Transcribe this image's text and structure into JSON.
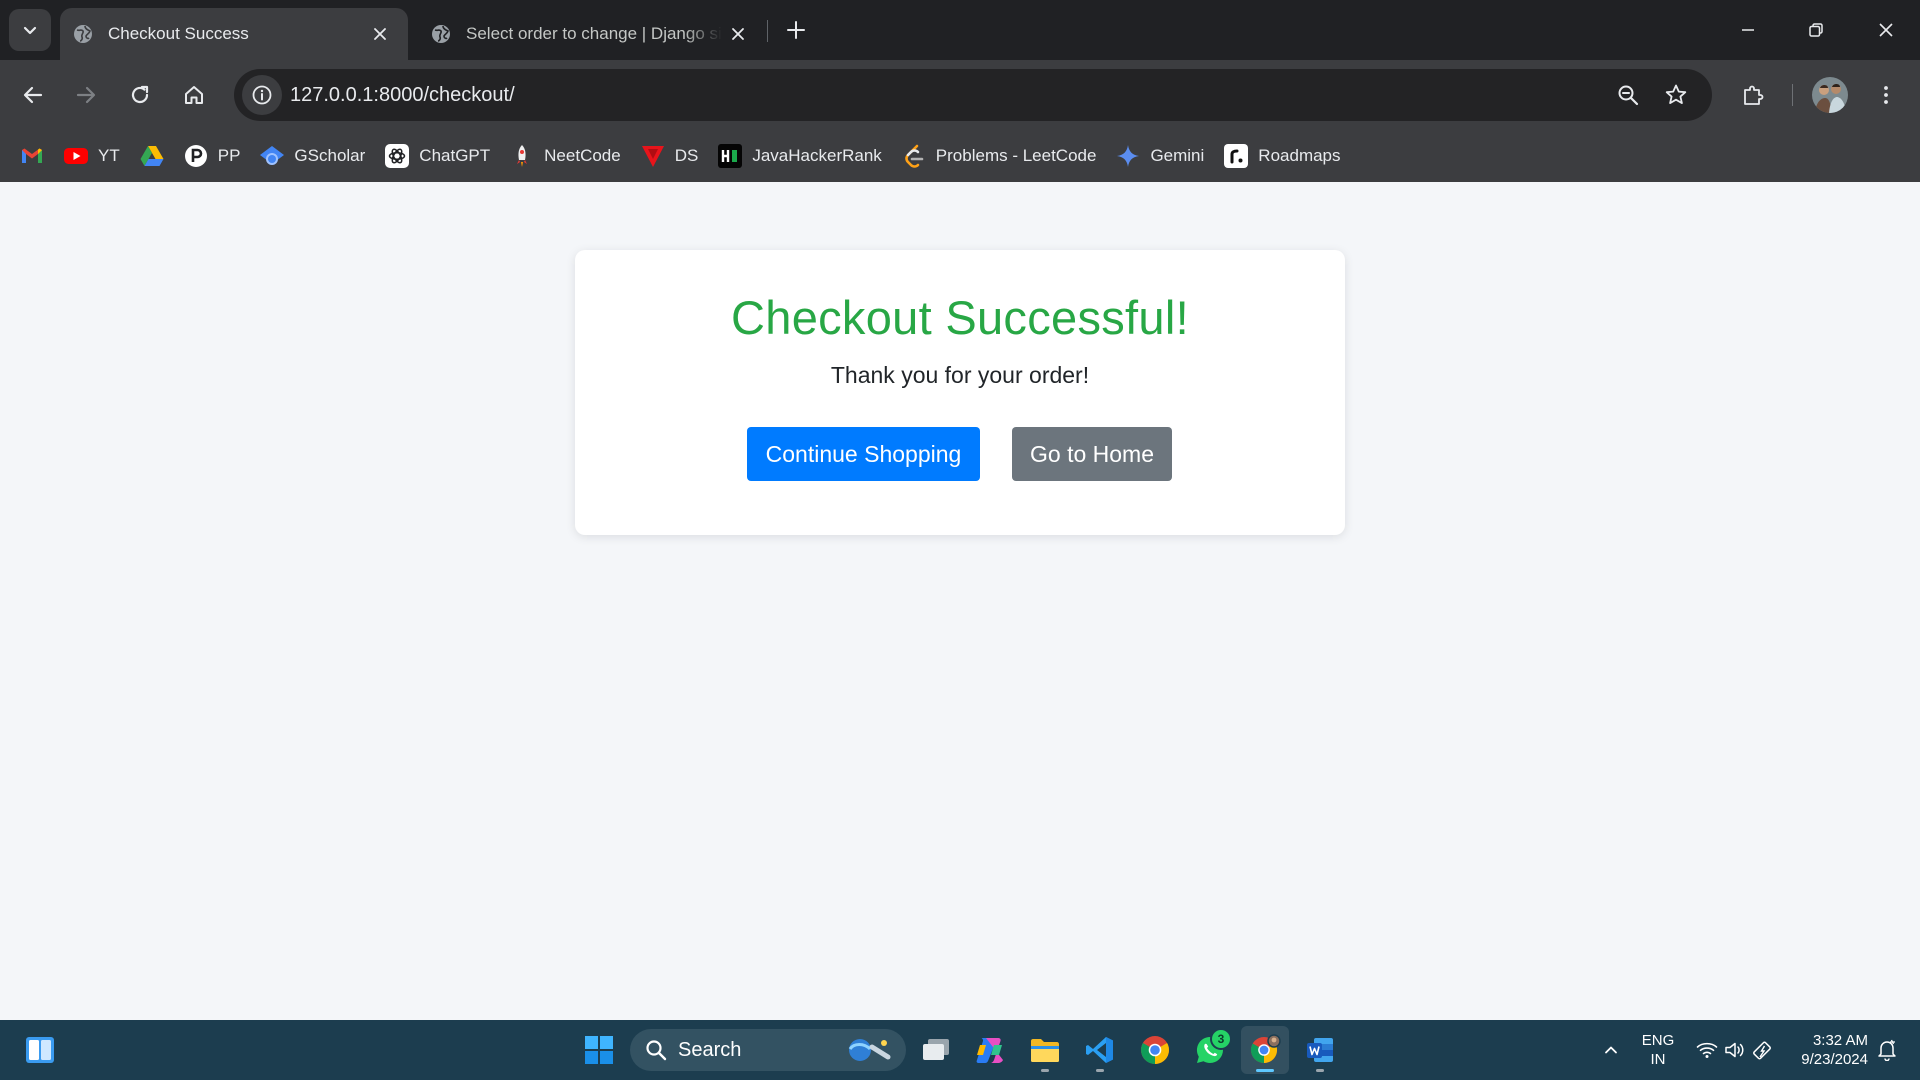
{
  "browser": {
    "tabs": [
      {
        "title": "Checkout Success",
        "active": true
      },
      {
        "title": "Select order to change | Django site admin",
        "active": false
      }
    ],
    "address_bar": {
      "url": "127.0.0.1:8000/checkout/"
    },
    "bookmarks": [
      {
        "label": "",
        "icon": "gmail-icon"
      },
      {
        "label": "YT",
        "icon": "youtube-icon"
      },
      {
        "label": "",
        "icon": "google-drive-icon"
      },
      {
        "label": "PP",
        "icon": "pp-icon"
      },
      {
        "label": "GScholar",
        "icon": "gscholar-icon"
      },
      {
        "label": "ChatGPT",
        "icon": "chatgpt-icon"
      },
      {
        "label": "NeetCode",
        "icon": "neetcode-icon"
      },
      {
        "label": "DS",
        "icon": "ds-icon"
      },
      {
        "label": "JavaHackerRank",
        "icon": "hackerrank-icon"
      },
      {
        "label": "Problems - LeetCode",
        "icon": "leetcode-icon"
      },
      {
        "label": "Gemini",
        "icon": "gemini-icon"
      },
      {
        "label": "Roadmaps",
        "icon": "roadmaps-icon"
      }
    ]
  },
  "page": {
    "heading": "Checkout Successful!",
    "message": "Thank you for your order!",
    "continue_button": "Continue Shopping",
    "home_button": "Go to Home",
    "colors": {
      "heading": "#28a745",
      "primary": "#007bff",
      "secondary": "#6c757d"
    }
  },
  "taskbar": {
    "search_label": "Search",
    "whatsapp_badge": "3",
    "language": {
      "line1": "ENG",
      "line2": "IN"
    },
    "time": "3:32 AM",
    "date": "9/23/2024"
  }
}
